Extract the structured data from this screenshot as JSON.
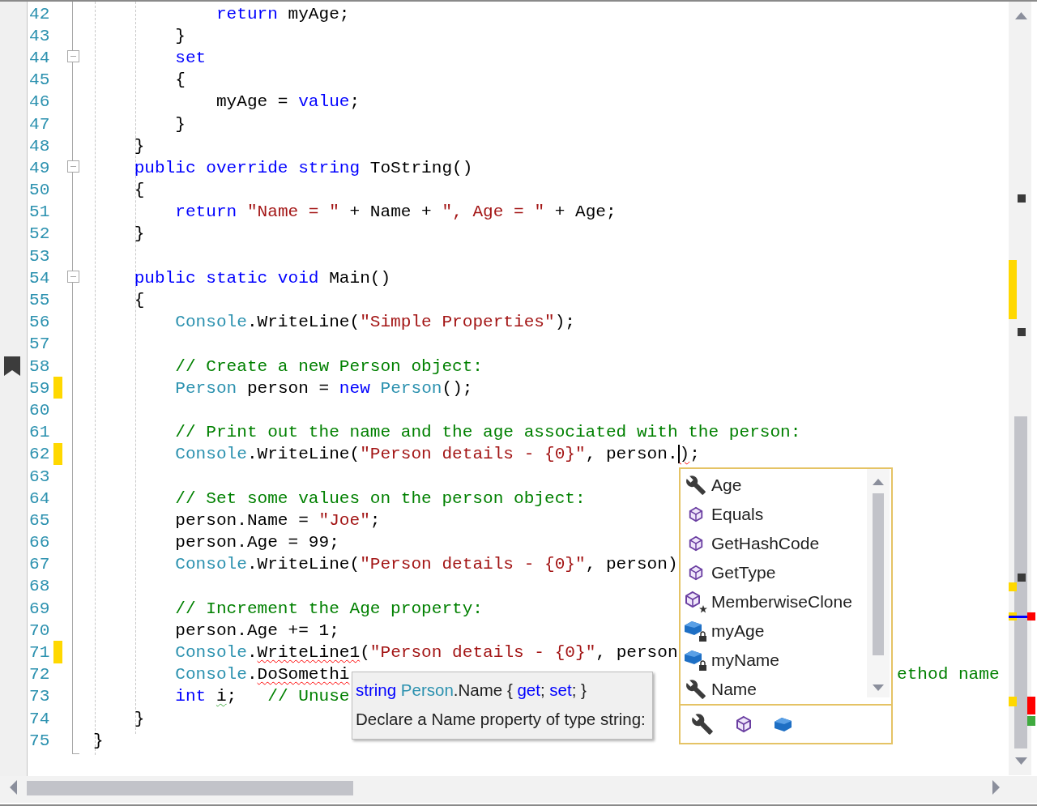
{
  "editor": {
    "lines": [
      {
        "number": "42",
        "changed": false,
        "bookmark": false,
        "foldable": false,
        "code": [
          {
            "text": "            return",
            "kind": "keyword"
          },
          {
            "text": " myAge;",
            "kind": "plain"
          }
        ]
      },
      {
        "number": "43",
        "changed": false,
        "bookmark": false,
        "foldable": false,
        "code": [
          {
            "text": "        }",
            "kind": "plain"
          }
        ]
      },
      {
        "number": "44",
        "changed": false,
        "bookmark": false,
        "foldable": true,
        "code": [
          {
            "text": "        set",
            "kind": "keyword"
          }
        ]
      },
      {
        "number": "45",
        "changed": false,
        "bookmark": false,
        "foldable": false,
        "code": [
          {
            "text": "        {",
            "kind": "plain"
          }
        ]
      },
      {
        "number": "46",
        "changed": false,
        "bookmark": false,
        "foldable": false,
        "code": [
          {
            "text": "            myAge =",
            "kind": "plain"
          },
          {
            "text": " value",
            "kind": "keyword"
          },
          {
            "text": ";",
            "kind": "plain"
          }
        ]
      },
      {
        "number": "47",
        "changed": false,
        "bookmark": false,
        "foldable": false,
        "code": [
          {
            "text": "        }",
            "kind": "plain"
          }
        ]
      },
      {
        "number": "48",
        "changed": false,
        "bookmark": false,
        "foldable": false,
        "code": [
          {
            "text": "    }",
            "kind": "plain"
          }
        ]
      },
      {
        "number": "49",
        "changed": false,
        "bookmark": false,
        "foldable": true,
        "code": [
          {
            "text": "    public override string",
            "kind": "keyword"
          },
          {
            "text": " ToString()",
            "kind": "plain"
          }
        ]
      },
      {
        "number": "50",
        "changed": false,
        "bookmark": false,
        "foldable": false,
        "code": [
          {
            "text": "    {",
            "kind": "plain"
          }
        ]
      },
      {
        "number": "51",
        "changed": false,
        "bookmark": false,
        "foldable": false,
        "code": [
          {
            "text": "        return",
            "kind": "keyword"
          },
          {
            "text": " \"Name = \"",
            "kind": "string"
          },
          {
            "text": " + Name +",
            "kind": "plain"
          },
          {
            "text": " \", Age = \"",
            "kind": "string"
          },
          {
            "text": " + Age;",
            "kind": "plain"
          }
        ]
      },
      {
        "number": "52",
        "changed": false,
        "bookmark": false,
        "foldable": false,
        "code": [
          {
            "text": "    }",
            "kind": "plain"
          }
        ]
      },
      {
        "number": "53",
        "changed": false,
        "bookmark": false,
        "foldable": false
      },
      {
        "number": "54",
        "changed": false,
        "bookmark": false,
        "foldable": true,
        "code": [
          {
            "text": "    public static void",
            "kind": "keyword"
          },
          {
            "text": " Main()",
            "kind": "plain"
          }
        ]
      },
      {
        "number": "55",
        "changed": false,
        "bookmark": false,
        "foldable": false,
        "code": [
          {
            "text": "    {",
            "kind": "plain"
          }
        ]
      },
      {
        "number": "56",
        "changed": false,
        "bookmark": false,
        "foldable": false,
        "code": [
          {
            "text": "        Console",
            "kind": "type"
          },
          {
            "text": ".WriteLine(",
            "kind": "plain"
          },
          {
            "text": "\"Simple Properties\"",
            "kind": "string"
          },
          {
            "text": ");",
            "kind": "plain"
          }
        ]
      },
      {
        "number": "57",
        "changed": false,
        "bookmark": false,
        "foldable": false
      },
      {
        "number": "58",
        "changed": false,
        "bookmark": true,
        "foldable": false,
        "code": [
          {
            "text": "        // Create a new Person object:",
            "kind": "comment"
          }
        ]
      },
      {
        "number": "59",
        "changed": true,
        "bookmark": false,
        "foldable": false,
        "code": [
          {
            "text": "        Person",
            "kind": "type"
          },
          {
            "text": " person =",
            "kind": "plain"
          },
          {
            "text": " new",
            "kind": "keyword"
          },
          {
            "text": " Person",
            "kind": "type"
          },
          {
            "text": "();",
            "kind": "plain"
          }
        ]
      },
      {
        "number": "60",
        "changed": false,
        "bookmark": false,
        "foldable": false
      },
      {
        "number": "61",
        "changed": false,
        "bookmark": false,
        "foldable": false,
        "code": [
          {
            "text": "        // Print out the name and the age associated with the person:",
            "kind": "comment"
          }
        ]
      },
      {
        "number": "62",
        "changed": true,
        "bookmark": false,
        "foldable": false,
        "code": [
          {
            "text": "        Console",
            "kind": "type"
          },
          {
            "text": ".WriteLine(",
            "kind": "plain"
          },
          {
            "text": "\"Person details - {0}\"",
            "kind": "string"
          },
          {
            "text": ", person.",
            "kind": "plain"
          },
          {
            "text": ")",
            "kind": "caret-error"
          },
          {
            "text": ";",
            "kind": "plain"
          }
        ]
      },
      {
        "number": "63",
        "changed": false,
        "bookmark": false,
        "foldable": false
      },
      {
        "number": "64",
        "changed": false,
        "bookmark": false,
        "foldable": false,
        "code": [
          {
            "text": "        // Set some values on the person object:",
            "kind": "comment"
          }
        ]
      },
      {
        "number": "65",
        "changed": false,
        "bookmark": false,
        "foldable": false,
        "code": [
          {
            "text": "        person.Name =",
            "kind": "plain"
          },
          {
            "text": " \"Joe\"",
            "kind": "string"
          },
          {
            "text": ";",
            "kind": "plain"
          }
        ]
      },
      {
        "number": "66",
        "changed": false,
        "bookmark": false,
        "foldable": false,
        "code": [
          {
            "text": "        person.Age = 99;",
            "kind": "plain"
          }
        ]
      },
      {
        "number": "67",
        "changed": false,
        "bookmark": false,
        "foldable": false,
        "code": [
          {
            "text": "        Console",
            "kind": "type"
          },
          {
            "text": ".WriteLine(",
            "kind": "plain"
          },
          {
            "text": "\"Person details - {0}\"",
            "kind": "string"
          },
          {
            "text": ", person)",
            "kind": "plain"
          }
        ]
      },
      {
        "number": "68",
        "changed": false,
        "bookmark": false,
        "foldable": false
      },
      {
        "number": "69",
        "changed": false,
        "bookmark": false,
        "foldable": false,
        "code": [
          {
            "text": "        // Increment the Age property:",
            "kind": "comment"
          }
        ]
      },
      {
        "number": "70",
        "changed": false,
        "bookmark": false,
        "foldable": false,
        "code": [
          {
            "text": "        person.Age += 1;",
            "kind": "plain"
          }
        ]
      },
      {
        "number": "71",
        "changed": true,
        "bookmark": false,
        "foldable": false,
        "code": [
          {
            "text": "        Console",
            "kind": "type"
          },
          {
            "text": ".",
            "kind": "plain"
          },
          {
            "text": "WriteLine1",
            "kind": "error"
          },
          {
            "text": "(",
            "kind": "plain"
          },
          {
            "text": "\"Person details - {0}\"",
            "kind": "string"
          },
          {
            "text": ", person",
            "kind": "plain"
          }
        ]
      },
      {
        "number": "72",
        "changed": false,
        "bookmark": false,
        "foldable": false,
        "code": [
          {
            "text": "        Console",
            "kind": "type"
          },
          {
            "text": ".",
            "kind": "plain"
          },
          {
            "text": "DoSomethi",
            "kind": "error"
          },
          {
            "text": "ethod name",
            "kind": "comment-after-popup"
          }
        ]
      },
      {
        "number": "73",
        "changed": false,
        "bookmark": false,
        "foldable": false,
        "code": [
          {
            "text": "        int",
            "kind": "keyword"
          },
          {
            "text": " i",
            "kind": "warning"
          },
          {
            "text": ";",
            "kind": "plain"
          },
          {
            "text": "   // Unuse",
            "kind": "comment"
          }
        ]
      },
      {
        "number": "74",
        "changed": false,
        "bookmark": false,
        "foldable": false,
        "code": [
          {
            "text": "    }",
            "kind": "plain"
          }
        ]
      },
      {
        "number": "75",
        "changed": false,
        "bookmark": false,
        "foldable": false,
        "code": [
          {
            "text": "}",
            "kind": "plain"
          }
        ]
      }
    ]
  },
  "completion": {
    "items": [
      {
        "label": "Age",
        "kind": "property",
        "selected": false
      },
      {
        "label": "Equals",
        "kind": "method",
        "selected": false
      },
      {
        "label": "GetHashCode",
        "kind": "method",
        "selected": false
      },
      {
        "label": "GetType",
        "kind": "method",
        "selected": false
      },
      {
        "label": "MemberwiseClone",
        "kind": "protected-method",
        "selected": false
      },
      {
        "label": "myAge",
        "kind": "private-field",
        "selected": false
      },
      {
        "label": "myName",
        "kind": "private-field",
        "selected": false
      },
      {
        "label": "Name",
        "kind": "property",
        "selected": false
      }
    ],
    "filters": [
      {
        "kind": "property",
        "selected": false
      },
      {
        "kind": "method",
        "selected": false
      },
      {
        "kind": "field",
        "selected": false
      }
    ]
  },
  "tooltip": {
    "signature": [
      {
        "text": "string",
        "kind": "keyword"
      },
      {
        "text": " Person",
        "kind": "type"
      },
      {
        "text": ".Name {",
        "kind": "plain"
      },
      {
        "text": " get",
        "kind": "keyword"
      },
      {
        "text": ";",
        "kind": "plain"
      },
      {
        "text": " set",
        "kind": "keyword"
      },
      {
        "text": "; }",
        "kind": "plain"
      }
    ],
    "description": "Declare a Name property of type string:"
  }
}
